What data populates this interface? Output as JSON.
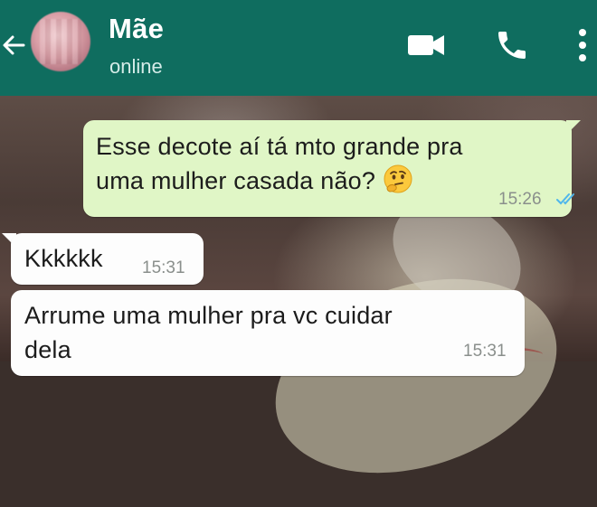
{
  "header": {
    "contact_name": "Mãe",
    "status": "online",
    "icons": [
      "back-arrow-icon",
      "avatar",
      "video-call-icon",
      "phone-call-icon",
      "more-options-icon"
    ]
  },
  "messages": [
    {
      "direction": "outgoing",
      "lines": [
        "Esse decote aí tá mto grande pra",
        "uma mulher casada não?"
      ],
      "emoji": "thinking-face",
      "time": "15:26",
      "status": "read"
    },
    {
      "direction": "incoming",
      "lines": [
        "Kkkkkk"
      ],
      "time": "15:31"
    },
    {
      "direction": "incoming",
      "lines": [
        "Arrume uma mulher pra vc cuidar",
        "dela"
      ],
      "time": "15:31"
    }
  ],
  "colors": {
    "header": "#0f6d5f",
    "outgoing_bubble": "#e0f6c6",
    "incoming_bubble": "#fdfdfd",
    "read_ticks": "#4fb6ec"
  }
}
